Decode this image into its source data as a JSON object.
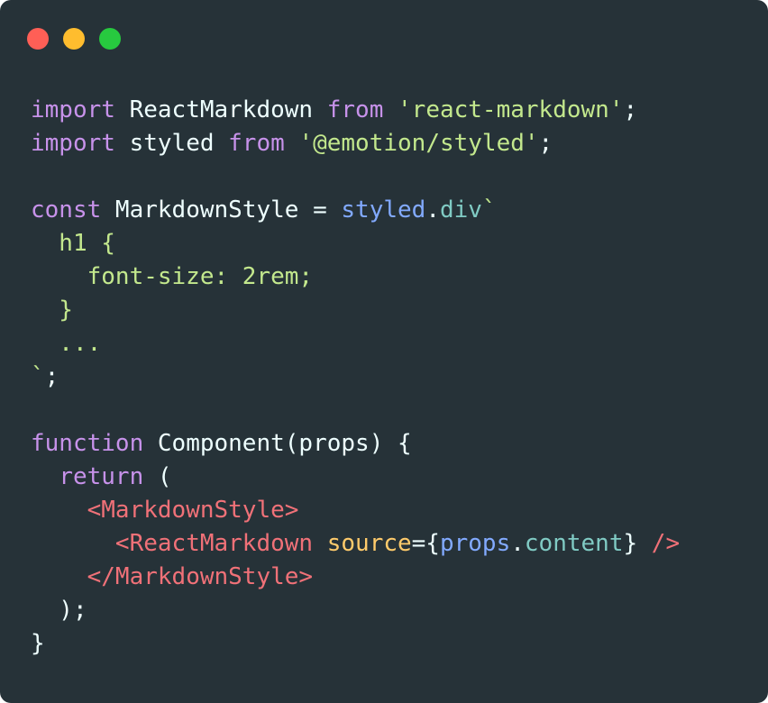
{
  "window": {
    "background": "#263238",
    "controls": [
      {
        "name": "close",
        "color": "#ff5f56"
      },
      {
        "name": "minimize",
        "color": "#ffbd2e"
      },
      {
        "name": "maximize",
        "color": "#27c93f"
      }
    ]
  },
  "colors": {
    "keyword": "#c792ea",
    "plain": "#eeffff",
    "string": "#c3e88d",
    "function": "#82aaff",
    "property": "#80cbc4",
    "tag": "#f07178",
    "attribute": "#ffcb6b"
  },
  "code": {
    "lines": [
      [
        {
          "t": "import",
          "c": "keyword"
        },
        {
          "t": " ReactMarkdown ",
          "c": "plain"
        },
        {
          "t": "from",
          "c": "keyword"
        },
        {
          "t": " ",
          "c": "plain"
        },
        {
          "t": "'react-markdown'",
          "c": "string"
        },
        {
          "t": ";",
          "c": "plain"
        }
      ],
      [
        {
          "t": "import",
          "c": "keyword"
        },
        {
          "t": " styled ",
          "c": "plain"
        },
        {
          "t": "from",
          "c": "keyword"
        },
        {
          "t": " ",
          "c": "plain"
        },
        {
          "t": "'@emotion/styled'",
          "c": "string"
        },
        {
          "t": ";",
          "c": "plain"
        }
      ],
      [],
      [
        {
          "t": "const",
          "c": "keyword"
        },
        {
          "t": " MarkdownStyle = ",
          "c": "plain"
        },
        {
          "t": "styled",
          "c": "function"
        },
        {
          "t": ".",
          "c": "plain"
        },
        {
          "t": "div",
          "c": "property"
        },
        {
          "t": "`",
          "c": "string"
        }
      ],
      [
        {
          "t": "  h1 {",
          "c": "string"
        }
      ],
      [
        {
          "t": "    font-size: 2rem;",
          "c": "string"
        }
      ],
      [
        {
          "t": "  }",
          "c": "string"
        }
      ],
      [
        {
          "t": "  ...",
          "c": "string"
        }
      ],
      [
        {
          "t": "`",
          "c": "string"
        },
        {
          "t": ";",
          "c": "plain"
        }
      ],
      [],
      [
        {
          "t": "function",
          "c": "keyword"
        },
        {
          "t": " Component(props) {",
          "c": "plain"
        }
      ],
      [
        {
          "t": "  ",
          "c": "plain"
        },
        {
          "t": "return",
          "c": "keyword"
        },
        {
          "t": " (",
          "c": "plain"
        }
      ],
      [
        {
          "t": "    ",
          "c": "plain"
        },
        {
          "t": "<MarkdownStyle>",
          "c": "tag"
        }
      ],
      [
        {
          "t": "      ",
          "c": "plain"
        },
        {
          "t": "<ReactMarkdown",
          "c": "tag"
        },
        {
          "t": " ",
          "c": "plain"
        },
        {
          "t": "source",
          "c": "attribute"
        },
        {
          "t": "={",
          "c": "plain"
        },
        {
          "t": "props",
          "c": "function"
        },
        {
          "t": ".",
          "c": "plain"
        },
        {
          "t": "content",
          "c": "property"
        },
        {
          "t": "} ",
          "c": "plain"
        },
        {
          "t": "/>",
          "c": "tag"
        }
      ],
      [
        {
          "t": "    ",
          "c": "plain"
        },
        {
          "t": "</MarkdownStyle>",
          "c": "tag"
        }
      ],
      [
        {
          "t": "  );",
          "c": "plain"
        }
      ],
      [
        {
          "t": "}",
          "c": "plain"
        }
      ]
    ]
  }
}
